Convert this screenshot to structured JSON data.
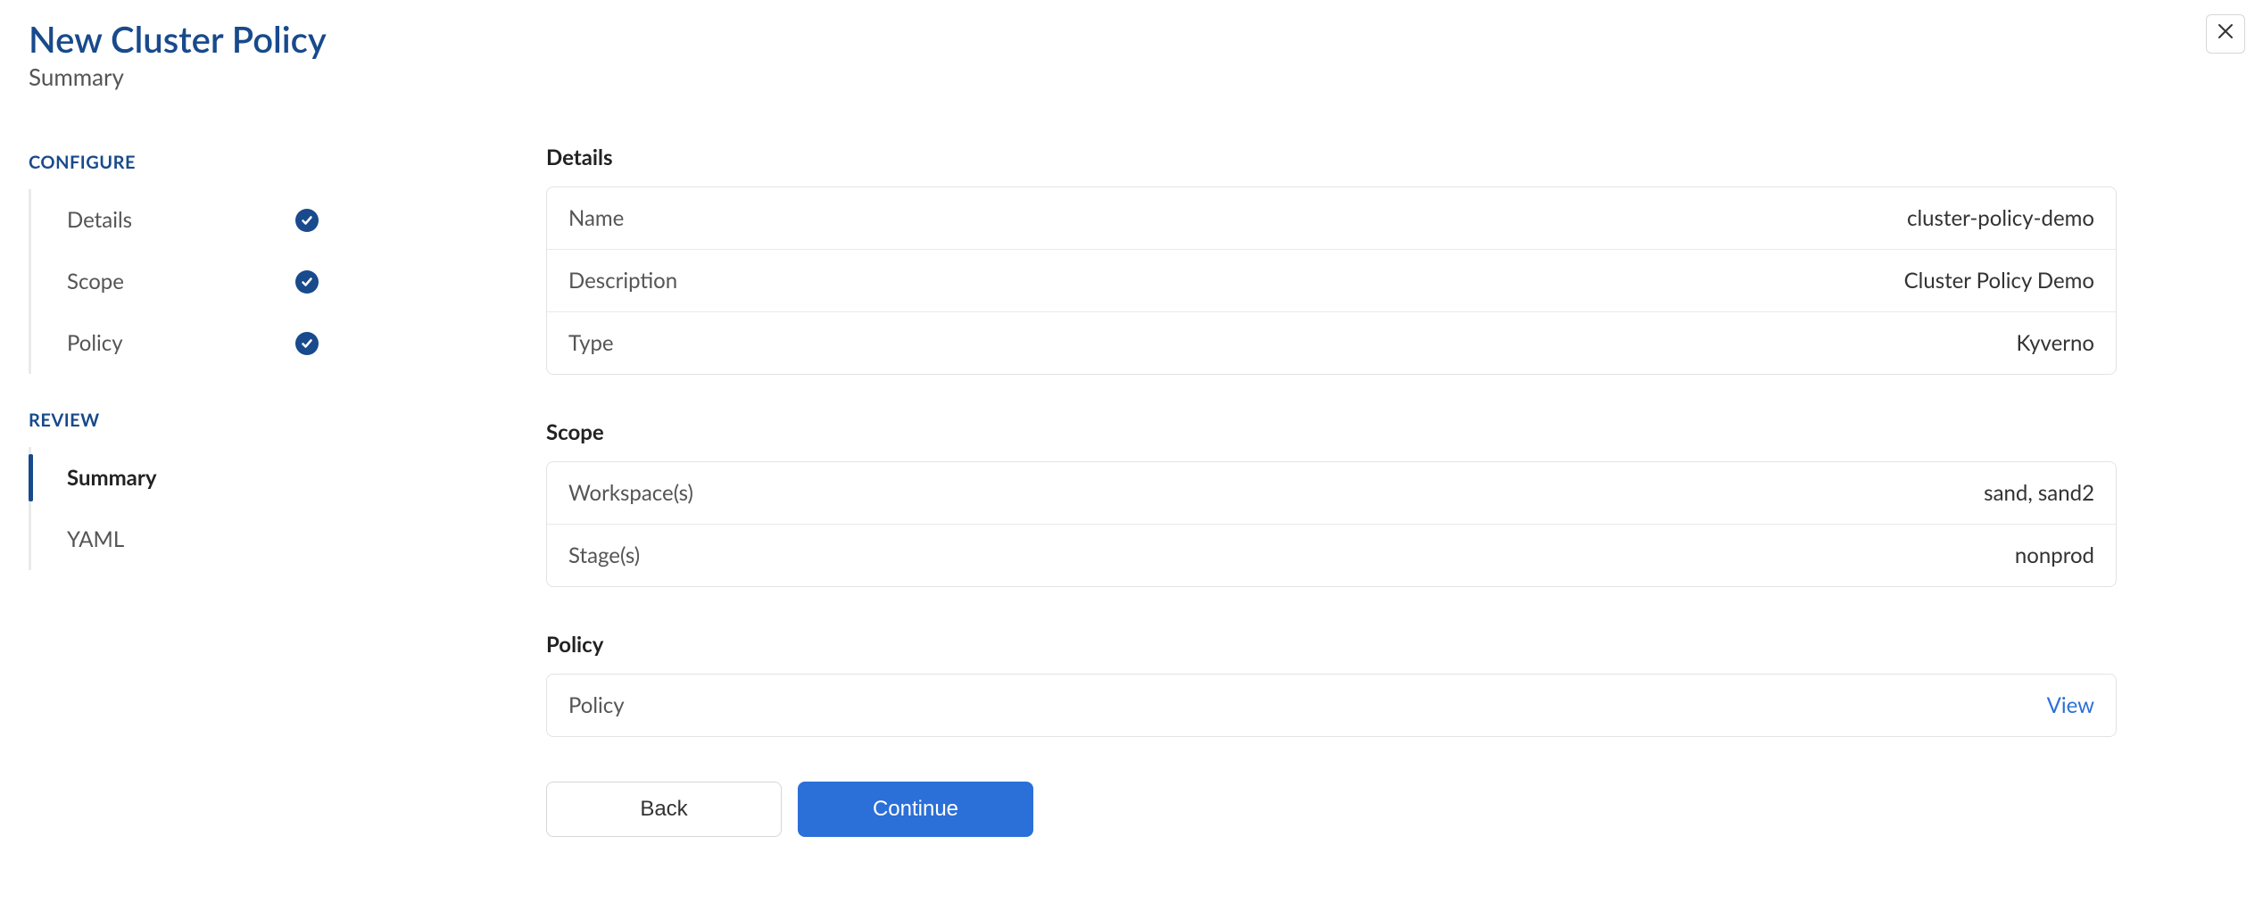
{
  "header": {
    "title": "New Cluster Policy",
    "subtitle": "Summary"
  },
  "sidebar": {
    "configure_label": "CONFIGURE",
    "review_label": "REVIEW",
    "configure_items": [
      {
        "label": "Details",
        "done": true
      },
      {
        "label": "Scope",
        "done": true
      },
      {
        "label": "Policy",
        "done": true
      }
    ],
    "review_items": [
      {
        "label": "Summary",
        "active": true
      },
      {
        "label": "YAML",
        "active": false
      }
    ]
  },
  "summary": {
    "details": {
      "heading": "Details",
      "rows": {
        "name": {
          "label": "Name",
          "value": "cluster-policy-demo"
        },
        "description": {
          "label": "Description",
          "value": "Cluster Policy Demo"
        },
        "type": {
          "label": "Type",
          "value": "Kyverno"
        }
      }
    },
    "scope": {
      "heading": "Scope",
      "rows": {
        "workspaces": {
          "label": "Workspace(s)",
          "value": "sand, sand2"
        },
        "stages": {
          "label": "Stage(s)",
          "value": "nonprod"
        }
      }
    },
    "policy": {
      "heading": "Policy",
      "rows": {
        "policy": {
          "label": "Policy",
          "link": "View"
        }
      }
    }
  },
  "footer": {
    "back_label": "Back",
    "continue_label": "Continue"
  }
}
